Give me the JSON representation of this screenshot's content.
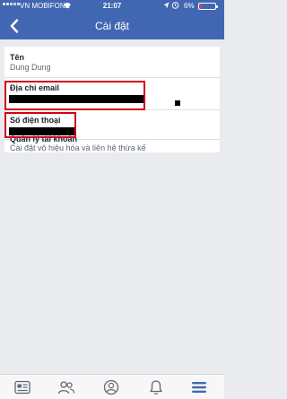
{
  "status_bar": {
    "carrier": "VN MOBIFONE",
    "time": "21:07",
    "battery": "6%"
  },
  "nav": {
    "title": "Cài đặt"
  },
  "settings": {
    "name_label": "Tên",
    "name_value": "Dung Dung",
    "email_label": "Địa chỉ email",
    "phone_label": "Số điện thoại",
    "account_label": "Quản lý tài khoản",
    "account_desc": "Cài đặt vô hiệu hóa và liên hệ thừa kế"
  },
  "tabbar": {
    "icons": [
      "news-feed-icon",
      "friends-icon",
      "profile-icon",
      "notifications-icon",
      "menu-icon"
    ],
    "active_index": 4
  },
  "colors": {
    "brand": "#4267b2",
    "highlight": "#d0021b",
    "battery_low": "#ff3b30"
  }
}
